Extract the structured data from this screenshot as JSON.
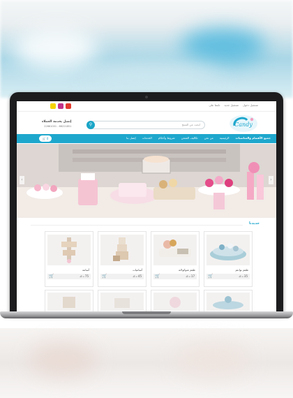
{
  "topbar": {
    "links": [
      "تسجيل دخول",
      "تسجيل جديد",
      "تابعنا على"
    ],
    "social": [
      {
        "icon": "snapchat-icon",
        "color": "#f5d400"
      },
      {
        "icon": "instagram-icon",
        "color": "#c2338a"
      },
      {
        "icon": "youtube-icon",
        "color": "#e23a2e"
      }
    ]
  },
  "header": {
    "logo_text": "Candy",
    "search_placeholder": "ابحث عن المنتج",
    "contact_title": "إتصل بخدمة العملاء",
    "contact_phones": "22661001 - 66221851"
  },
  "nav": {
    "items": [
      {
        "label": "جميع الأقسام والمناسبات",
        "strong": true
      },
      {
        "label": "الرئيسية"
      },
      {
        "label": "من نحن"
      },
      {
        "label": "تكاليف الشحن"
      },
      {
        "label": "شروط وأحكام"
      },
      {
        "label": "الخدمات"
      },
      {
        "label": "إتصل بنا"
      }
    ],
    "cart_count": "0"
  },
  "section": {
    "title": "جديدنا"
  },
  "products": [
    {
      "name": "طقم نواعم",
      "price": "35 د.ك",
      "icon": "cart-icon"
    },
    {
      "name": "طقم شوكولاتة",
      "price": "17 د.ك",
      "icon": "cart-icon"
    },
    {
      "name": "أساميات",
      "price": "45 د.ك",
      "icon": "cart-icon"
    },
    {
      "name": "أسامة",
      "price": "75 د.ك",
      "icon": "cart-icon"
    }
  ],
  "colors": {
    "accent": "#1ea7cd",
    "laptop": "#1c1c1e"
  }
}
